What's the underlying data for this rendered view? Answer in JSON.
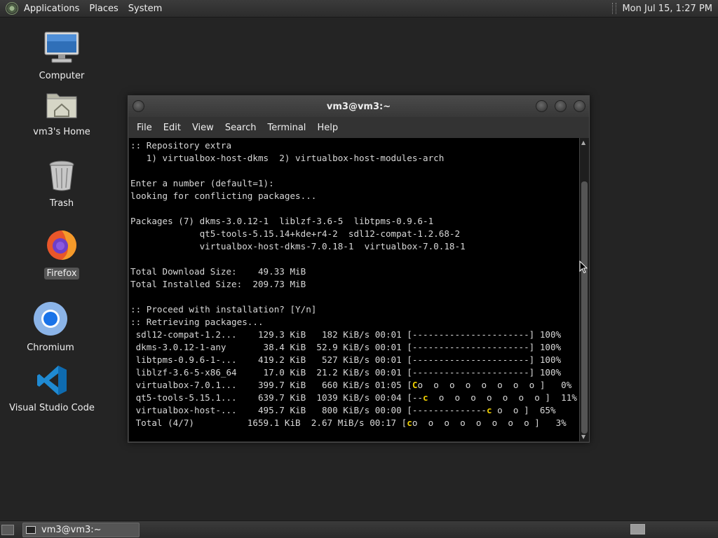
{
  "top_panel": {
    "menus": [
      "Applications",
      "Places",
      "System"
    ],
    "clock": "Mon Jul 15,  1:27 PM"
  },
  "desktop_icons": [
    {
      "label": "Computer",
      "icon": "computer-icon"
    },
    {
      "label": "vm3's Home",
      "icon": "home-folder-icon"
    },
    {
      "label": "Trash",
      "icon": "trash-icon"
    },
    {
      "label": "Firefox",
      "icon": "firefox-icon"
    },
    {
      "label": "Chromium",
      "icon": "chromium-icon"
    },
    {
      "label": "Visual Studio Code",
      "icon": "vscode-icon"
    }
  ],
  "window": {
    "title": "vm3@vm3:~",
    "menu": [
      "File",
      "Edit",
      "View",
      "Search",
      "Terminal",
      "Help"
    ]
  },
  "terminal_lines": [
    ":: Repository extra",
    "   1) virtualbox-host-dkms  2) virtualbox-host-modules-arch",
    "",
    "Enter a number (default=1):",
    "looking for conflicting packages...",
    "",
    "Packages (7) dkms-3.0.12-1  liblzf-3.6-5  libtpms-0.9.6-1",
    "             qt5-tools-5.15.14+kde+r4-2  sdl12-compat-1.2.68-2",
    "             virtualbox-host-dkms-7.0.18-1  virtualbox-7.0.18-1",
    "",
    "Total Download Size:    49.33 MiB",
    "Total Installed Size:  209.73 MiB",
    "",
    ":: Proceed with installation? [Y/n]",
    ":: Retrieving packages...",
    " sdl12-compat-1.2...    129.3 KiB   182 KiB/s 00:01 [----------------------] 100%",
    " dkms-3.0.12-1-any       38.4 KiB  52.9 KiB/s 00:01 [----------------------] 100%",
    " libtpms-0.9.6-1-...    419.2 KiB   527 KiB/s 00:01 [----------------------] 100%",
    " liblzf-3.6-5-x86_64     17.0 KiB  21.2 KiB/s 00:01 [----------------------] 100%",
    " virtualbox-7.0.1...    399.7 KiB   660 KiB/s 01:05 [Co  o  o  o  o  o  o  o ]   0%",
    " qt5-tools-5.15.1...    639.7 KiB  1039 KiB/s 00:04 [--c  o  o  o  o  o  o  o ]  11%",
    " virtualbox-host-...    495.7 KiB   800 KiB/s 00:00 [--------------c o  o ]  65%",
    " Total (4/7)          1659.1 KiB  2.67 MiB/s 00:17 [co  o  o  o  o  o  o  o ]   3%"
  ],
  "taskbar": {
    "task_label": "vm3@vm3:~"
  }
}
